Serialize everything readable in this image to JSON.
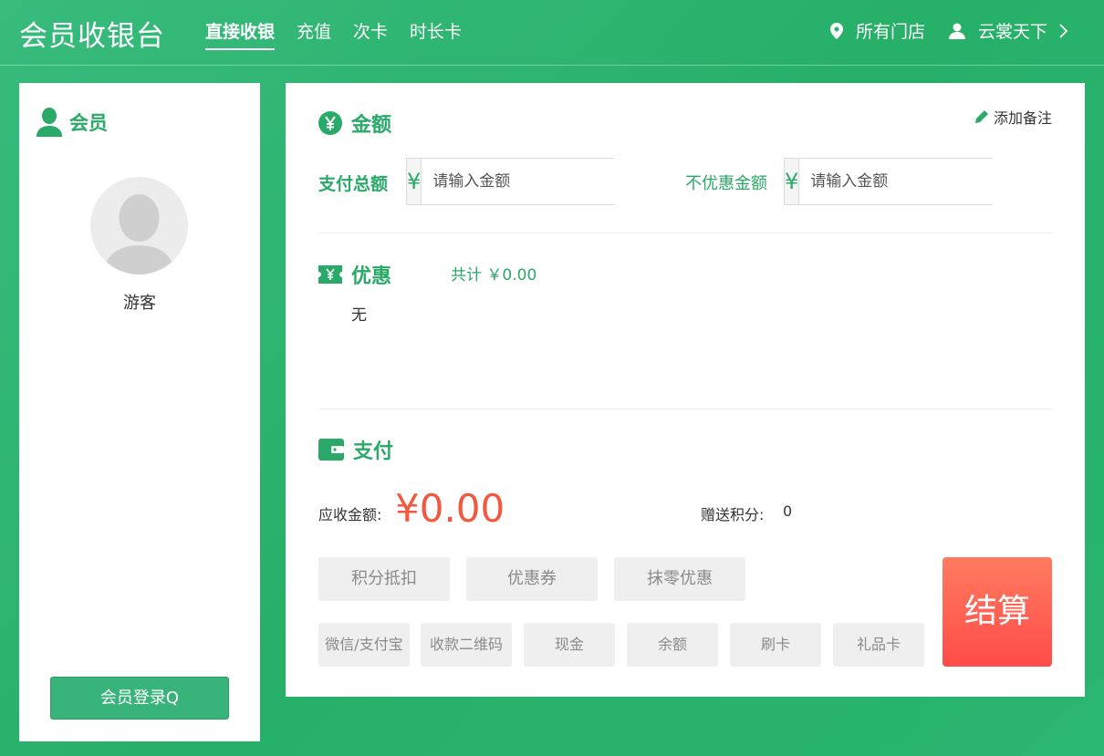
{
  "header": {
    "app_title": "会员收银台",
    "nav": [
      {
        "label": "直接收银",
        "active": true
      },
      {
        "label": "充值",
        "active": false
      },
      {
        "label": "次卡",
        "active": false
      },
      {
        "label": "时长卡",
        "active": false
      }
    ],
    "store_label": "所有门店",
    "user_label": "云裳天下"
  },
  "member_panel": {
    "title": "会员",
    "guest_name": "游客",
    "login_button": "会员登录Q"
  },
  "amount_section": {
    "title": "金额",
    "add_note": "添加备注",
    "total_label": "支付总额",
    "total_placeholder": "请输入金额",
    "no_discount_label": "不优惠金额",
    "no_discount_placeholder": "请输入金额",
    "currency_symbol": "¥"
  },
  "discount_section": {
    "title": "优惠",
    "total_text": "共计 ￥0.00",
    "none_text": "无"
  },
  "payment_section": {
    "title": "支付",
    "due_label": "应收金额:",
    "due_amount": "¥0.00",
    "points_label": "赠送积分:",
    "points_value": "0",
    "deduct_buttons": [
      "积分抵扣",
      "优惠券",
      "抹零优惠"
    ],
    "methods": [
      "微信/支付宝",
      "收款二维码",
      "现金",
      "余额",
      "刷卡",
      "礼品卡"
    ],
    "settle_button": "结算"
  },
  "colors": {
    "brand_green": "#2aa968",
    "accent_red": "#f2583e",
    "settle_gradient_top": "#ff7b60",
    "settle_gradient_bottom": "#ff4c48"
  }
}
